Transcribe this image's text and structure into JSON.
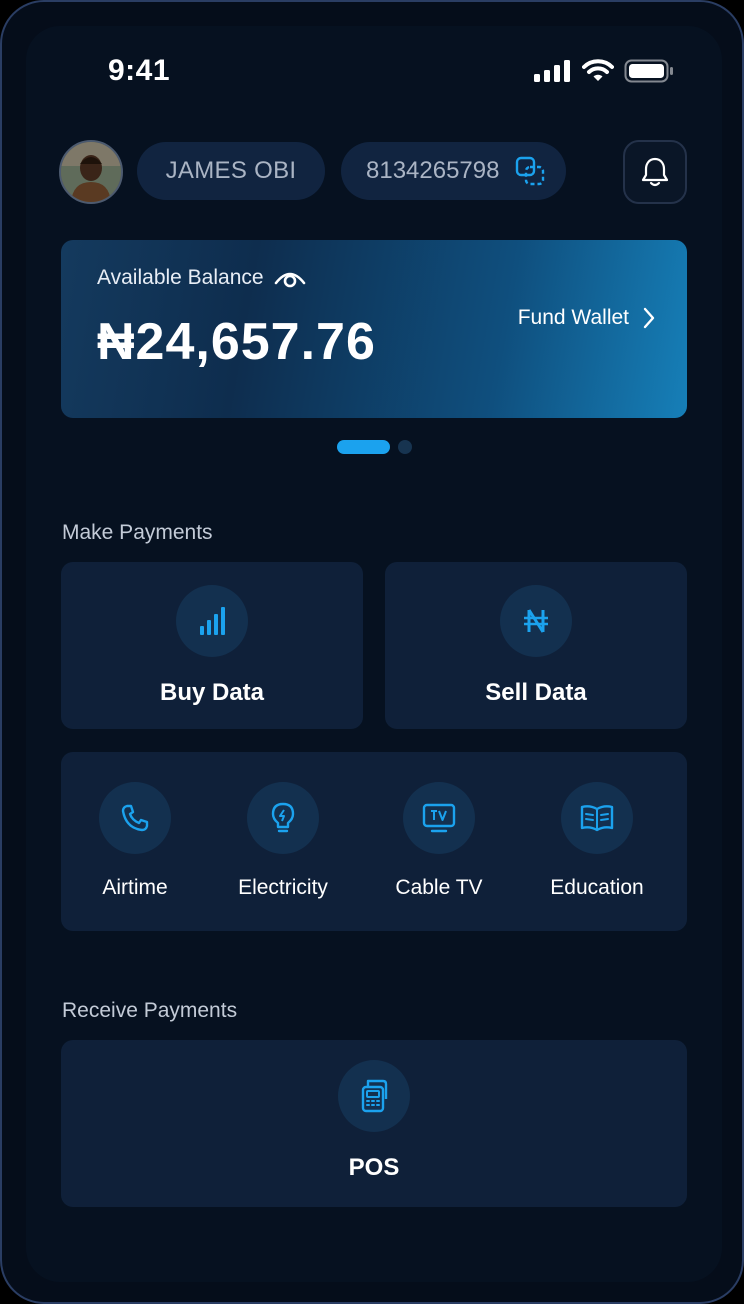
{
  "status_bar": {
    "time": "9:41"
  },
  "header": {
    "user_name": "JAMES OBI",
    "account_number": "8134265798"
  },
  "balance": {
    "label": "Available Balance",
    "amount": "₦24,657.76",
    "fund_label": "Fund Wallet",
    "carousel_active_index": 0,
    "carousel_count": 2
  },
  "make_payments": {
    "title": "Make Payments",
    "buy_data": "Buy Data",
    "sell_data": "Sell Data",
    "bills": [
      {
        "label": "Airtime",
        "icon": "phone-icon"
      },
      {
        "label": "Electricity",
        "icon": "bulb-icon"
      },
      {
        "label": "Cable TV",
        "icon": "tv-icon"
      },
      {
        "label": "Education",
        "icon": "book-icon"
      }
    ]
  },
  "receive_payments": {
    "title": "Receive Payments",
    "pos": "POS"
  },
  "colors": {
    "accent": "#1ba2ee",
    "background": "#061120",
    "card": "#0f2039"
  }
}
